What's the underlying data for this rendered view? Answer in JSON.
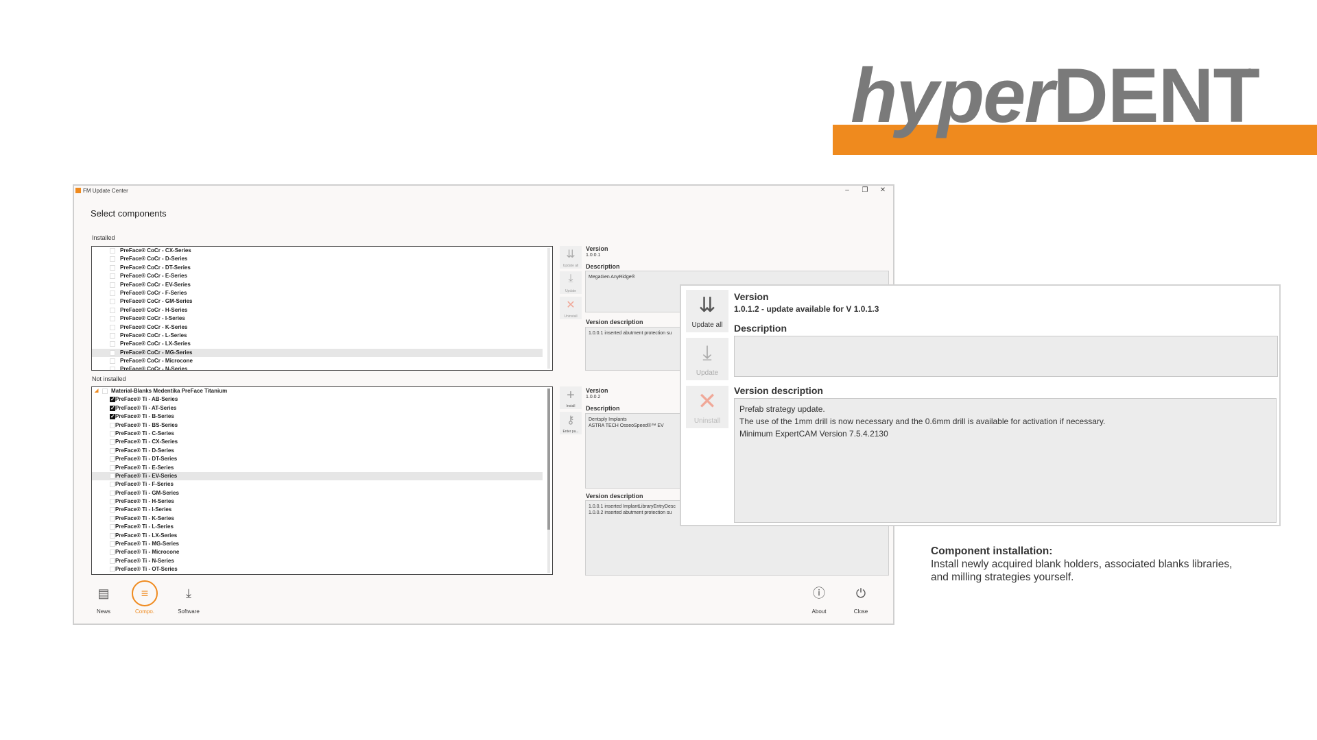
{
  "logo": {
    "text_italic": "hyper",
    "text_bold": "DENT",
    "reg": "®",
    "band_color": "#ef8a1e"
  },
  "window": {
    "title": "FM Update Center",
    "controls": {
      "minimize": "–",
      "restore": "❐",
      "close": "✕"
    },
    "heading": "Select components",
    "installed_label": "Installed",
    "installed_items": [
      {
        "label": "PreFace® CoCr - CX-Series",
        "checked": false,
        "selected": false
      },
      {
        "label": "PreFace® CoCr - D-Series",
        "checked": false,
        "selected": false
      },
      {
        "label": "PreFace® CoCr - DT-Series",
        "checked": false,
        "selected": false
      },
      {
        "label": "PreFace® CoCr - E-Series",
        "checked": false,
        "selected": false
      },
      {
        "label": "PreFace® CoCr - EV-Series",
        "checked": false,
        "selected": false
      },
      {
        "label": "PreFace® CoCr - F-Series",
        "checked": false,
        "selected": false
      },
      {
        "label": "PreFace® CoCr - GM-Series",
        "checked": false,
        "selected": false
      },
      {
        "label": "PreFace® CoCr - H-Series",
        "checked": false,
        "selected": false
      },
      {
        "label": "PreFace® CoCr - I-Series",
        "checked": false,
        "selected": false
      },
      {
        "label": "PreFace® CoCr - K-Series",
        "checked": false,
        "selected": false
      },
      {
        "label": "PreFace® CoCr - L-Series",
        "checked": false,
        "selected": false
      },
      {
        "label": "PreFace® CoCr - LX-Series",
        "checked": false,
        "selected": false
      },
      {
        "label": "PreFace® CoCr - MG-Series",
        "checked": false,
        "selected": true
      },
      {
        "label": "PreFace® CoCr - Microcone",
        "checked": false,
        "selected": false
      },
      {
        "label": "PreFace® CoCr - N-Series",
        "checked": false,
        "selected": false
      }
    ],
    "installed_buttons": {
      "update_all": "Update all",
      "update": "Update",
      "uninstall": "Uninstall"
    },
    "installed_detail": {
      "version_label": "Version",
      "version_value": "1.0.0.1",
      "description_label": "Description",
      "description_value": "MegaGen AnyRidge®",
      "version_description_label": "Version description",
      "version_description_value": "1.0.0.1 inserted abutment protection su"
    },
    "not_installed_label": "Not installed",
    "not_installed_group": "Material-Blanks Medentika PreFace Titanium",
    "not_installed_items": [
      {
        "label": "PreFace® Ti - AB-Series",
        "checked": true,
        "selected": false
      },
      {
        "label": "PreFace® Ti - AT-Series",
        "checked": true,
        "selected": false
      },
      {
        "label": "PreFace® Ti - B-Series",
        "checked": true,
        "selected": false
      },
      {
        "label": "PreFace® Ti - BS-Series",
        "checked": false,
        "selected": false
      },
      {
        "label": "PreFace® Ti - C-Series",
        "checked": false,
        "selected": false
      },
      {
        "label": "PreFace® Ti - CX-Series",
        "checked": false,
        "selected": false
      },
      {
        "label": "PreFace® Ti - D-Series",
        "checked": false,
        "selected": false
      },
      {
        "label": "PreFace® Ti - DT-Series",
        "checked": false,
        "selected": false
      },
      {
        "label": "PreFace® Ti - E-Series",
        "checked": false,
        "selected": false
      },
      {
        "label": "PreFace® Ti - EV-Series",
        "checked": false,
        "selected": true
      },
      {
        "label": "PreFace® Ti - F-Series",
        "checked": false,
        "selected": false
      },
      {
        "label": "PreFace® Ti - GM-Series",
        "checked": false,
        "selected": false
      },
      {
        "label": "PreFace® Ti - H-Series",
        "checked": false,
        "selected": false
      },
      {
        "label": "PreFace® Ti - I-Series",
        "checked": false,
        "selected": false
      },
      {
        "label": "PreFace® Ti - K-Series",
        "checked": false,
        "selected": false
      },
      {
        "label": "PreFace® Ti - L-Series",
        "checked": false,
        "selected": false
      },
      {
        "label": "PreFace® Ti - LX-Series",
        "checked": false,
        "selected": false
      },
      {
        "label": "PreFace® Ti - MG-Series",
        "checked": false,
        "selected": false
      },
      {
        "label": "PreFace® Ti - Microcone",
        "checked": false,
        "selected": false
      },
      {
        "label": "PreFace® Ti - N-Series",
        "checked": false,
        "selected": false
      },
      {
        "label": "PreFace® Ti - OT-Series",
        "checked": false,
        "selected": false
      }
    ],
    "not_installed_buttons": {
      "install": "Install",
      "enter_password": "Enter pa..."
    },
    "not_installed_detail": {
      "version_label": "Version",
      "version_value": "1.0.0.2",
      "description_label": "Description",
      "description_line1": "Dentsply Implants",
      "description_line2": "ASTRA TECH OsseoSpeed®™ EV",
      "version_description_label": "Version description",
      "version_description_line1": "1.0.0.1 inserted ImplantLibraryEntryDesc",
      "version_description_line2": "1.0.0.2 inserted abutment protection su"
    },
    "nav": {
      "news": "News",
      "components": "Compo.",
      "software": "Software",
      "about": "About",
      "close": "Close"
    }
  },
  "zoom": {
    "buttons": {
      "update_all": "Update all",
      "update": "Update",
      "uninstall": "Uninstall"
    },
    "version_label": "Version",
    "version_value": "1.0.1.2 - update available for V 1.0.1.3",
    "description_label": "Description",
    "version_description_label": "Version description",
    "version_description_lines": [
      "Prefab strategy update.",
      "The use of the 1mm drill is now necessary and the 0.6mm drill is available for activation if necessary.",
      "Minimum ExpertCAM Version 7.5.4.2130"
    ]
  },
  "caption": {
    "title": "Component installation:",
    "body": "Install newly acquired blank holders, associated blanks libraries, and milling strategies yourself."
  }
}
